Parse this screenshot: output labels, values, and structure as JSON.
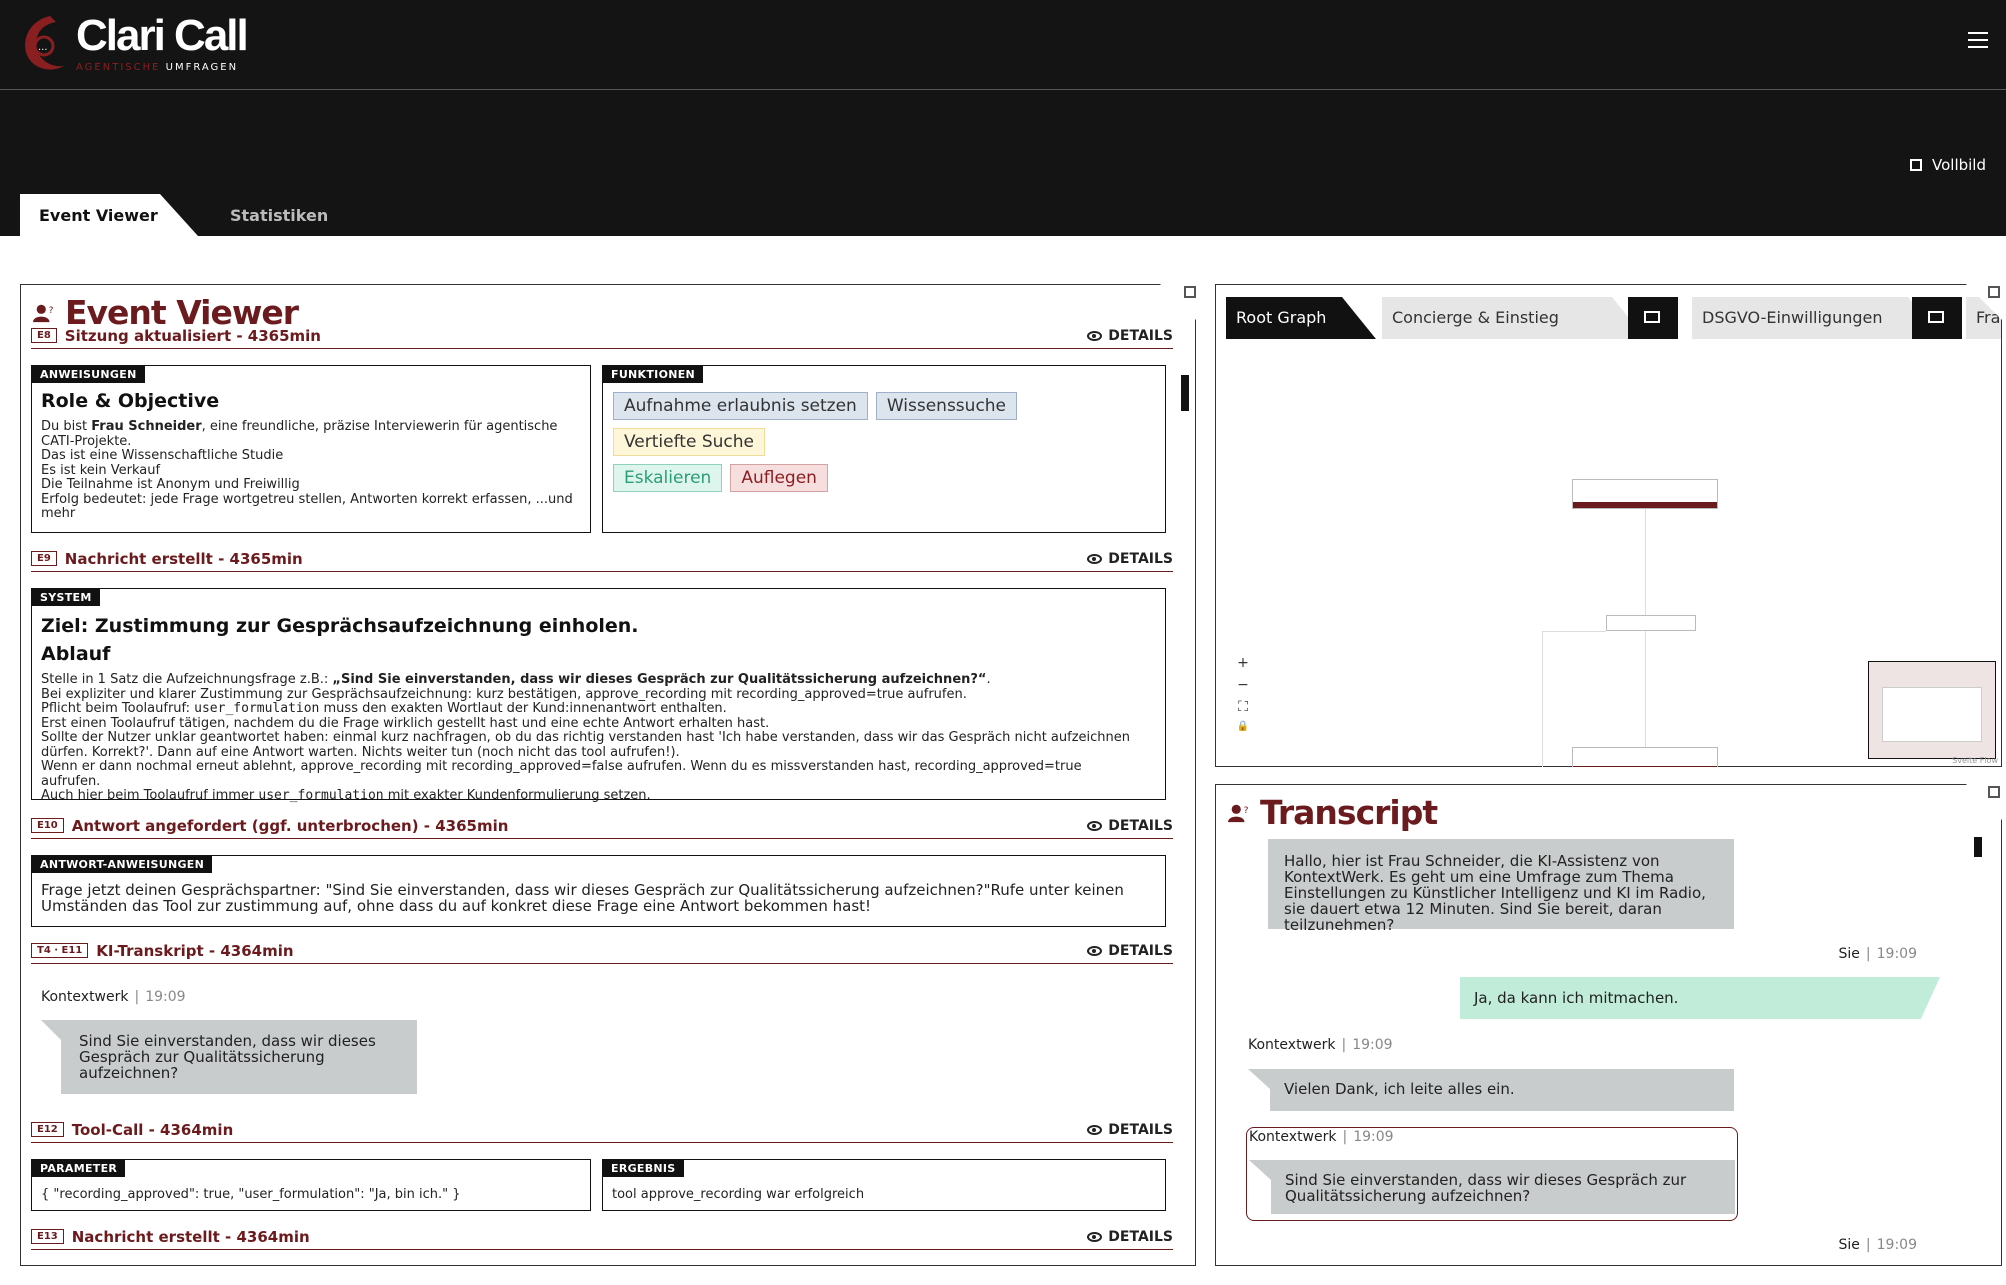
{
  "brand": {
    "name": "Clari Call",
    "sub_1": "AGENTISCHE",
    "sub_2": "UMFRAGEN"
  },
  "toolbar": {
    "fullscreen_label": "Vollbild"
  },
  "tabs": [
    {
      "label": "Event Viewer"
    },
    {
      "label": "Statistiken"
    }
  ],
  "event_viewer": {
    "title": "Event Viewer",
    "details_label": "DETAILS",
    "e8": {
      "badge": "E8",
      "title": "Sitzung aktualisiert - 4365min",
      "anweisungen_label": "ANWEISUNGEN",
      "heading": "Role & Objective",
      "line1_pre": "Du bist ",
      "line1_bold": "Frau Schneider",
      "line1_post": ", eine freundliche, präzise Interviewerin für agentische CATI-Projekte.",
      "line2": "Das ist eine Wissenschaftliche Studie",
      "line3": "Es ist kein Verkauf",
      "line4": "Die Teilnahme ist Anonym und Freiwillig",
      "line5": "Erfolg bedeutet: jede Frage wortgetreu stellen, Antworten korrekt erfassen, ...und mehr",
      "funktionen_label": "FUNKTIONEN",
      "chips": [
        "Aufnahme erlaubnis setzen",
        "Wissenssuche",
        "Vertiefte Suche",
        "Eskalieren",
        "Auflegen"
      ]
    },
    "e9": {
      "badge": "E9",
      "title": "Nachricht erstellt - 4365min",
      "system_label": "SYSTEM",
      "heading": "Ziel: Zustimmung zur Gesprächsaufzeichnung einholen.",
      "subheading": "Ablauf",
      "l1_pre": "Stelle in 1 Satz die Aufzeichnungsfrage z.B.: ",
      "l1_bold": "„Sind Sie einverstanden, dass wir dieses Gespräch zur Qualitätssicherung aufzeichnen?“",
      "l1_post": ".",
      "l2": "Bei expliziter und klarer Zustimmung zur Gesprächsaufzeichnung: kurz bestätigen, approve_recording mit recording_approved=true aufrufen.",
      "l3_pre": "Pflicht beim Toolaufruf: ",
      "l3_code": "user_formulation",
      "l3_post": " muss den exakten Wortlaut der Kund:innenantwort enthalten.",
      "l4": "Erst einen Toolaufruf tätigen, nachdem du die Frage wirklich gestellt hast und eine echte Antwort erhalten hast.",
      "l5": "Sollte der Nutzer unklar geantwortet haben: einmal kurz nachfragen, ob du das richtig verstanden hast 'Ich habe verstanden, dass wir das Gespräch nicht aufzeichnen dürfen. Korrekt?'. Dann auf eine Antwort warten. Nichts weiter tun (noch nicht das tool aufrufen!).",
      "l6": "Wenn er dann nochmal erneut ablehnt, approve_recording mit recording_approved=false aufrufen. Wenn du es missverstanden hast, recording_approved=true aufrufen.",
      "l7_pre": "Auch hier beim Toolaufruf immer ",
      "l7_code": "user_formulation",
      "l7_post": " mit exakter Kundenformulierung setzen."
    },
    "e10": {
      "badge": "E10",
      "title": "Antwort angefordert (ggf. unterbrochen) - 4365min",
      "label": "ANTWORT-ANWEISUNGEN",
      "text": "Frage jetzt deinen Gesprächspartner: \"Sind Sie einverstanden, dass wir dieses Gespräch zur Qualitätssicherung aufzeichnen?\"Rufe unter keinen Umständen das Tool zur zustimmung auf, ohne dass du auf konkret diese Frage eine Antwort bekommen hast!"
    },
    "e11": {
      "badge": "T4 · E11",
      "title": "KI-Transkript - 4364min",
      "speaker": "Kontextwerk",
      "time": "19:09",
      "text": "Sind Sie einverstanden, dass wir dieses Gespräch zur Qualitätssicherung aufzeichnen?"
    },
    "e12": {
      "badge": "E12",
      "title": "Tool-Call - 4364min",
      "param_label": "PARAMETER",
      "param_text": "{ \"recording_approved\": true, \"user_formulation\": \"Ja, bin ich.\" }",
      "result_label": "ERGEBNIS",
      "result_text": "tool approve_recording war erfolgreich"
    },
    "e13": {
      "badge": "E13",
      "title": "Nachricht erstellt - 4364min"
    }
  },
  "graph": {
    "tabs": [
      "Root Graph",
      "Concierge & Einstieg",
      "DSGVO-Einwilligungen",
      "Fra"
    ],
    "controls": [
      "+",
      "−",
      "⛶",
      "🔒"
    ],
    "attribution": "Svelte Flow"
  },
  "transcript": {
    "title": "Transcript",
    "messages": [
      {
        "role": "agent",
        "text": "Hallo, hier ist Frau Schneider, die KI-Assistenz von KontextWerk. Es geht um eine Umfrage zum Thema Einstellungen zu Künstlicher Intelligenz und KI im Radio, sie dauert etwa 12 Minuten. Sind Sie bereit, daran teilzunehmen?"
      },
      {
        "role": "user",
        "speaker": "Sie",
        "time": "19:09",
        "text": "Ja, da kann ich mitmachen."
      },
      {
        "role": "agent",
        "speaker": "Kontextwerk",
        "time": "19:09",
        "text": "Vielen Dank, ich leite alles ein."
      },
      {
        "role": "agent",
        "speaker": "Kontextwerk",
        "time": "19:09",
        "text": "Sind Sie einverstanden, dass wir dieses Gespräch zur Qualitätssicherung aufzeichnen?"
      },
      {
        "role": "user",
        "speaker": "Sie",
        "time": "19:09"
      }
    ]
  },
  "colors": {
    "brand_red": "#6b1a1d",
    "header_bg": "#141414",
    "user_bubble": "#c0ecd9",
    "agent_bubble": "#c9cccc"
  }
}
